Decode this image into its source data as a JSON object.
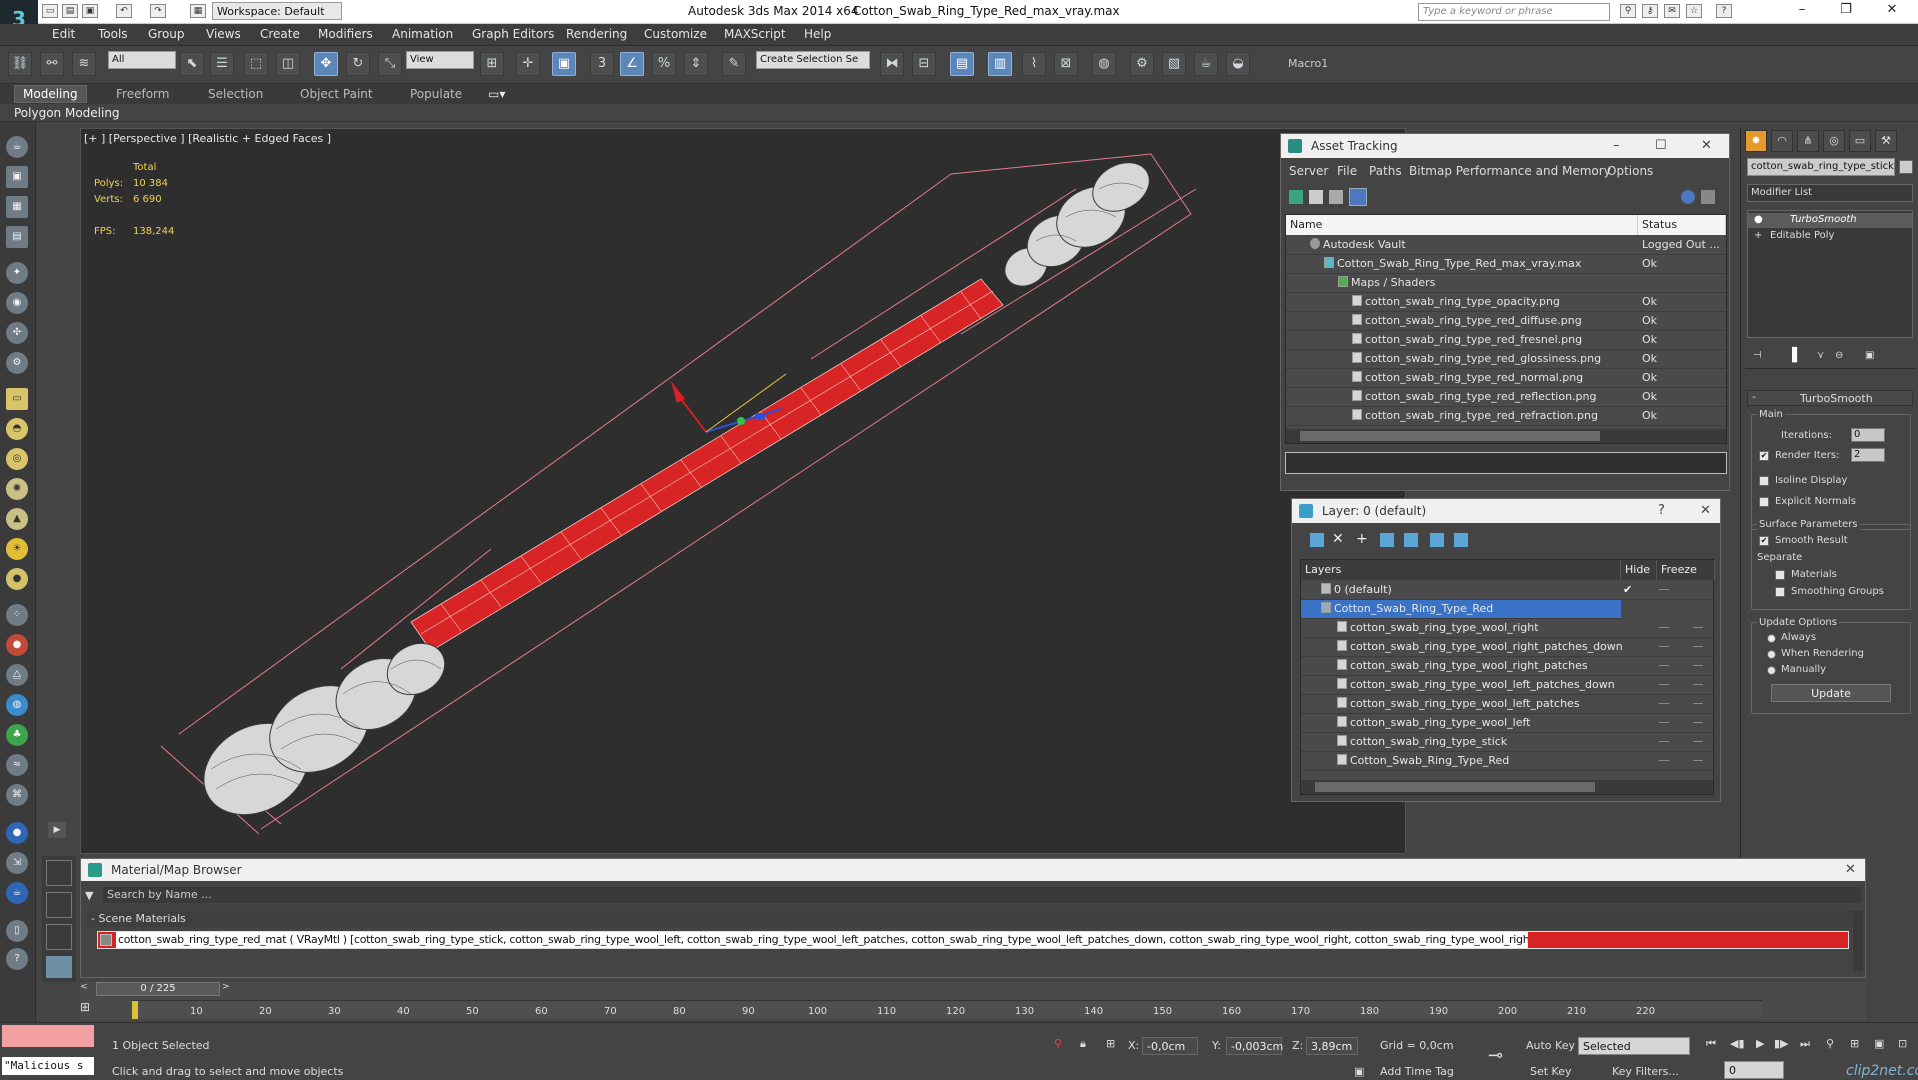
{
  "app": {
    "title": "Autodesk 3ds Max  2014 x64",
    "file": "Cotton_Swab_Ring_Type_Red_max_vray.max",
    "workspace": "Workspace: Default",
    "search_placeholder": "Type a keyword or phrase"
  },
  "menu": [
    "Edit",
    "Tools",
    "Group",
    "Views",
    "Create",
    "Modifiers",
    "Animation",
    "Graph Editors",
    "Rendering",
    "Customize",
    "MAXScript",
    "Help"
  ],
  "toolbar": {
    "filter": "All",
    "view": "View",
    "selection_set": "Create Selection Se",
    "snap_label": "3",
    "macro": "Macro1"
  },
  "ribbon": {
    "tabs": [
      "Modeling",
      "Freeform",
      "Selection",
      "Object Paint",
      "Populate"
    ],
    "active": "Modeling",
    "sub": "Polygon Modeling"
  },
  "viewport": {
    "label": "[+ ] [Perspective ] [Realistic + Edged Faces ]",
    "stats": {
      "total": "Total",
      "polys_label": "Polys:",
      "polys": "10 384",
      "verts_label": "Verts:",
      "verts": "6 690",
      "fps_label": "FPS:",
      "fps": "138,244"
    }
  },
  "asset_tracking": {
    "title": "Asset Tracking",
    "menu": [
      "Server",
      "File",
      "Paths",
      "Bitmap Performance and Memory",
      "Options"
    ],
    "columns": [
      "Name",
      "Status"
    ],
    "rows": [
      {
        "name": "Autodesk Vault",
        "status": "Logged Out ..."
      },
      {
        "name": "Cotton_Swab_Ring_Type_Red_max_vray.max",
        "status": "Ok"
      },
      {
        "name": "Maps / Shaders",
        "status": ""
      },
      {
        "name": "cotton_swab_ring_type_opacity.png",
        "status": "Ok"
      },
      {
        "name": "cotton_swab_ring_type_red_diffuse.png",
        "status": "Ok"
      },
      {
        "name": "cotton_swab_ring_type_red_fresnel.png",
        "status": "Ok"
      },
      {
        "name": "cotton_swab_ring_type_red_glossiness.png",
        "status": "Ok"
      },
      {
        "name": "cotton_swab_ring_type_red_normal.png",
        "status": "Ok"
      },
      {
        "name": "cotton_swab_ring_type_red_reflection.png",
        "status": "Ok"
      },
      {
        "name": "cotton_swab_ring_type_red_refraction.png",
        "status": "Ok"
      }
    ]
  },
  "layer_win": {
    "title": "Layer: 0 (default)",
    "columns": [
      "Layers",
      "Hide",
      "Freeze"
    ],
    "rows": [
      "0 (default)",
      "Cotton_Swab_Ring_Type_Red",
      "cotton_swab_ring_type_wool_right",
      "cotton_swab_ring_type_wool_right_patches_down",
      "cotton_swab_ring_type_wool_right_patches",
      "cotton_swab_ring_type_wool_left_patches_down",
      "cotton_swab_ring_type_wool_left_patches",
      "cotton_swab_ring_type_wool_left",
      "cotton_swab_ring_type_stick",
      "Cotton_Swab_Ring_Type_Red"
    ]
  },
  "command_panel": {
    "object_name": "cotton_swab_ring_type_stick",
    "modifier_list": "Modifier List",
    "stack": [
      "TurboSmooth",
      "Editable Poly"
    ],
    "rollout": "TurboSmooth",
    "main": "Main",
    "iterations_label": "Iterations:",
    "iterations": "0",
    "render_iters_label": "Render Iters:",
    "render_iters": "2",
    "isoline": "Isoline Display",
    "explicit_normals": "Explicit Normals",
    "surface_params": "Surface Parameters",
    "smooth_result": "Smooth Result",
    "separate": "Separate",
    "materials": "Materials",
    "smoothing_groups": "Smoothing Groups",
    "update_options": "Update Options",
    "always": "Always",
    "when_rendering": "When Rendering",
    "manually": "Manually",
    "update_button": "Update"
  },
  "material_browser": {
    "title": "Material/Map Browser",
    "search": "Search by Name ...",
    "section": "- Scene Materials",
    "entry": "cotton_swab_ring_type_red_mat ( VRayMtl ) [cotton_swab_ring_type_stick, cotton_swab_ring_type_wool_left, cotton_swab_ring_type_wool_left_patches, cotton_swab_ring_type_wool_left_patches_down, cotton_swab_ring_type_wool_right, cotton_swab_ring_type_wool_right_patches, cotton_swab_ring_type_wool_right_patches_down]"
  },
  "timeline": {
    "frame": "0 / 225",
    "ticks": [
      "10",
      "20",
      "30",
      "40",
      "50",
      "60",
      "70",
      "80",
      "90",
      "100",
      "110",
      "120",
      "130",
      "140",
      "150",
      "160",
      "170",
      "180",
      "190",
      "200",
      "210",
      "220"
    ]
  },
  "status": {
    "script": "\"Malicious s",
    "selected": "1 Object Selected",
    "hint": "Click and drag to select and move objects",
    "x": "-0,0cm",
    "y": "-0,003cm",
    "z": "3,89cm",
    "grid": "Grid = 0,0cm",
    "add_time_tag": "Add Time Tag",
    "auto_key": "Auto Key",
    "set_key": "Set Key",
    "key_mode": "Selected",
    "key_filters": "Key Filters...",
    "frame": "0",
    "watermark": "clip2net.com"
  }
}
